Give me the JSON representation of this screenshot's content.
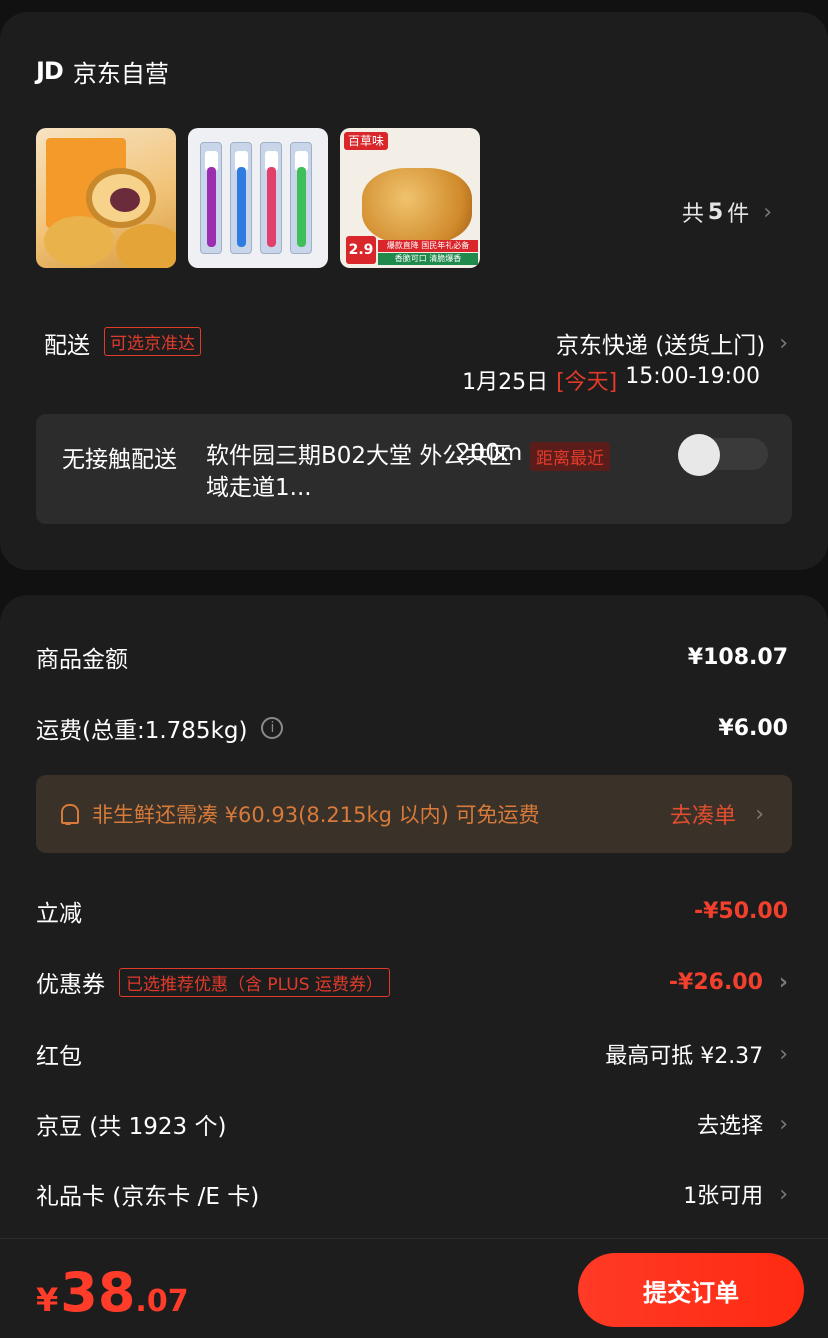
{
  "store": {
    "logo": "JD",
    "name": "京东自营"
  },
  "items": {
    "thumbs": [
      "mooncake-product",
      "toothbrush-product",
      "snack-product"
    ],
    "count_prefix": "共",
    "count": "5",
    "count_suffix": "件",
    "snack_logo": "百草味",
    "snack_price": "2.9",
    "snack_banner1": "爆款直降 国民年礼必备",
    "snack_banner2": "香脆可口 清脆爆香"
  },
  "delivery": {
    "label": "配送",
    "tag": "可选京准达",
    "method": "京东快递 (送货上门)",
    "date": "1月25日",
    "today": "[今天]",
    "time": "15:00-19:00"
  },
  "no_contact": {
    "label": "无接触配送",
    "address": "软件园三期B02大堂 外公共区域走道1...",
    "distance": "200m",
    "tag": "距离最近",
    "enabled": false
  },
  "summary": {
    "goods_label": "商品金额",
    "goods_value": "¥108.07",
    "freight_label": "运费(总重:1.785kg)",
    "freight_value": "¥6.00",
    "tip_message": "非生鲜还需凑 ¥60.93(8.215kg 以内) 可免运费",
    "tip_action": "去凑单",
    "discount_label": "立减",
    "discount_value": "-¥50.00",
    "coupon_label": "优惠券",
    "coupon_tag": "已选推荐优惠（含 PLUS 运费券）",
    "coupon_value": "-¥26.00",
    "redpacket_label": "红包",
    "redpacket_value": "最高可抵 ¥2.37",
    "jingdou_label": "京豆 (共 1923 个)",
    "jingdou_value": "去选择",
    "giftcard_label": "礼品卡 (京东卡 /E 卡)",
    "giftcard_value": "1张可用"
  },
  "footer": {
    "currency": "¥",
    "total_int": "38",
    "total_dec": ".07",
    "submit_label": "提交订单"
  },
  "colors": {
    "accent_red": "#ff3b2a",
    "tip_orange": "#d77a3a",
    "background": "#111111",
    "card": "#1d1d1d"
  }
}
